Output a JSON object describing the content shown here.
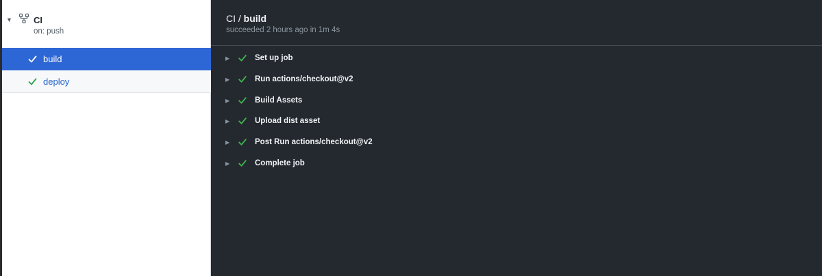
{
  "workflow": {
    "title": "CI",
    "trigger": "on: push",
    "caret": "▼",
    "icon": "workflow-icon"
  },
  "jobs": [
    {
      "label": "build",
      "status": "success",
      "selected": true
    },
    {
      "label": "deploy",
      "status": "success",
      "selected": false
    }
  ],
  "job_detail": {
    "prefix": "CI / ",
    "name": "build",
    "summary": "succeeded 2 hours ago in 1m 4s"
  },
  "steps": [
    {
      "label": "Set up job",
      "status": "success"
    },
    {
      "label": "Run actions/checkout@v2",
      "status": "success"
    },
    {
      "label": "Build Assets",
      "status": "success"
    },
    {
      "label": "Upload dist asset",
      "status": "success"
    },
    {
      "label": "Post Run actions/checkout@v2",
      "status": "success"
    },
    {
      "label": "Complete job",
      "status": "success"
    }
  ],
  "step_caret": "▶",
  "colors": {
    "selected_bg": "#2d66d5",
    "success": "#3fb950",
    "link": "#2563c9",
    "dark_bg": "#24292f"
  }
}
